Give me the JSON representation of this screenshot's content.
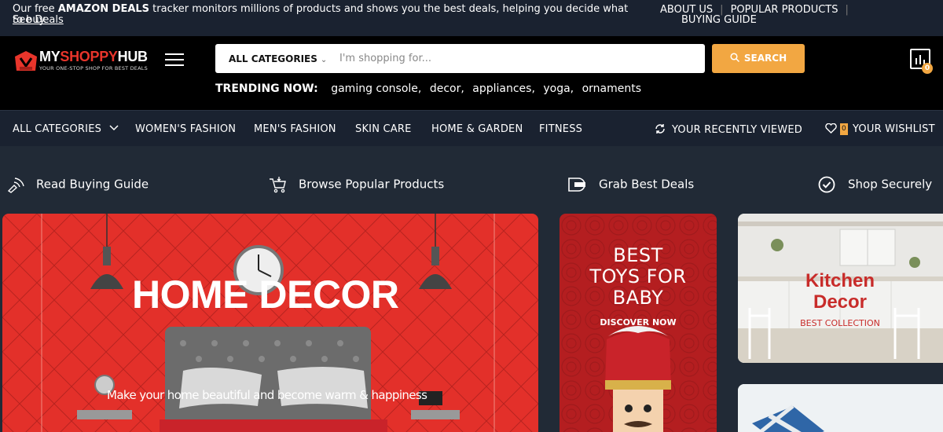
{
  "topbar": {
    "message_prefix": "Our free ",
    "message_bold": "AMAZON DEALS",
    "message_suffix": " tracker monitors millions of products and shows you the best deals, helping you decide what to buy.",
    "see_deals": "See Deals",
    "links": [
      "ABOUT US",
      "POPULAR PRODUCTS"
    ],
    "buying_guide": "BUYING GUIDE"
  },
  "header": {
    "logo_part1": "MY",
    "logo_part2": "SHOPPY",
    "logo_part3": "HUB",
    "logo_tagline": "YOUR ONE-STOP SHOP FOR BEST DEALS",
    "category_select": "ALL CATEGORIES",
    "search_placeholder": "I'm shopping for...",
    "search_button": "SEARCH",
    "trending_label": "TRENDING NOW:",
    "trending": [
      "gaming console,",
      "decor,",
      "appliances,",
      "yoga,",
      "ornaments"
    ],
    "cart_count": "0"
  },
  "nav": {
    "all_categories": "ALL CATEGORIES",
    "items": [
      "WOMEN'S FASHION",
      "MEN'S FASHION",
      "SKIN CARE",
      "HOME & GARDEN",
      "FITNESS"
    ],
    "recently_viewed": "YOUR RECENTLY VIEWED",
    "wishlist_count": "0",
    "wishlist": "YOUR WISHLIST"
  },
  "features": [
    {
      "label": "Read Buying Guide",
      "icon": "rss-guide-icon"
    },
    {
      "label": "Browse Popular Products",
      "icon": "cart-icon"
    },
    {
      "label": "Grab Best Deals",
      "icon": "deal-tag-icon"
    },
    {
      "label": "Shop Securely",
      "icon": "check-circle-icon"
    }
  ],
  "banners": {
    "main_title": "HOME DECOR",
    "main_subtitle": "Make your home beautiful and become warm & happiness",
    "toys_line1": "BEST",
    "toys_line2": "TOYS FOR",
    "toys_line3": "BABY",
    "toys_cta": "DISCOVER NOW",
    "kitchen_line1": "Kitchen",
    "kitchen_line2": "Decor",
    "kitchen_cta": "BEST COLLECTION"
  },
  "colors": {
    "accent": "#f2a742",
    "brand_red": "#e8352b",
    "background": "#212a36",
    "header_bg": "#000000"
  }
}
